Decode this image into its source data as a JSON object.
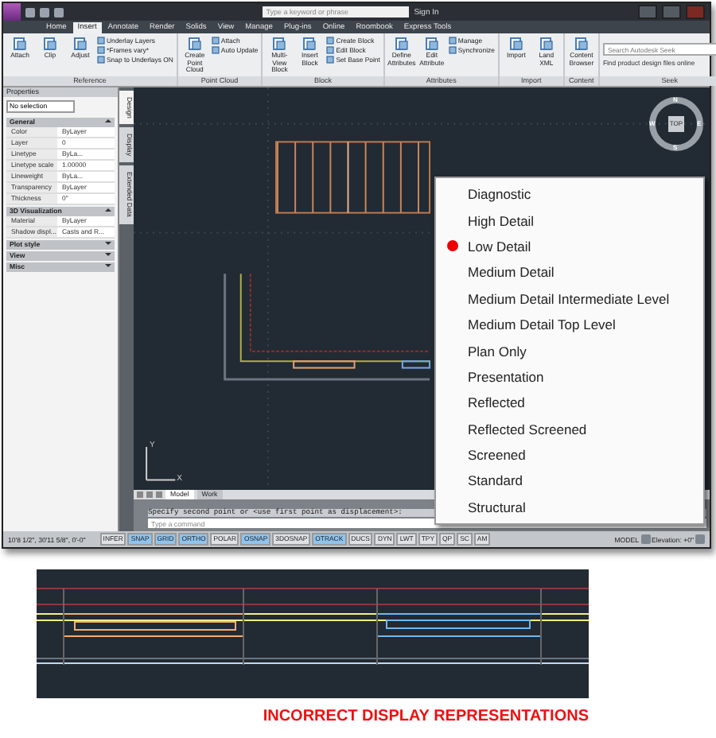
{
  "title_bar": {
    "search": {
      "placeholder": "Type a keyword or phrase"
    },
    "sign_in": "Sign In"
  },
  "ribbon_tabs": [
    {
      "label": "Home",
      "selected": false
    },
    {
      "label": "Insert",
      "selected": true
    },
    {
      "label": "Annotate",
      "selected": false
    },
    {
      "label": "Render",
      "selected": false
    },
    {
      "label": "Solids",
      "selected": false
    },
    {
      "label": "View",
      "selected": false
    },
    {
      "label": "Manage",
      "selected": false
    },
    {
      "label": "Plug-ins",
      "selected": false
    },
    {
      "label": "Online",
      "selected": false
    },
    {
      "label": "Roombook",
      "selected": false
    },
    {
      "label": "Express Tools",
      "selected": false
    }
  ],
  "ribbon_panels": [
    {
      "kind": "tools",
      "title": "Reference",
      "tools": [
        {
          "kind": "large",
          "label": "Attach"
        },
        {
          "kind": "large",
          "label": "Clip"
        },
        {
          "kind": "large",
          "label": "Adjust"
        },
        {
          "kind": "small",
          "label": "Underlay Layers"
        },
        {
          "kind": "small",
          "label": "*Frames vary*"
        },
        {
          "kind": "small",
          "label": "Snap to Underlays ON"
        }
      ]
    },
    {
      "kind": "tools",
      "title": "Point Cloud",
      "tools": [
        {
          "kind": "large",
          "label": "Create Point Cloud"
        },
        {
          "kind": "small",
          "label": "Attach"
        },
        {
          "kind": "small",
          "label": "Auto Update"
        }
      ]
    },
    {
      "kind": "tools",
      "title": "Block",
      "tools": [
        {
          "kind": "large",
          "label": "Multi-View Block"
        },
        {
          "kind": "large",
          "label": "Insert Block"
        },
        {
          "kind": "small",
          "label": "Create Block"
        },
        {
          "kind": "small",
          "label": "Edit Block"
        },
        {
          "kind": "small",
          "label": "Set Base Point"
        }
      ]
    },
    {
      "kind": "tools",
      "title": "Attributes",
      "tools": [
        {
          "kind": "large",
          "label": "Define Attributes"
        },
        {
          "kind": "large",
          "label": "Edit Attribute"
        },
        {
          "kind": "small",
          "label": "Manage"
        },
        {
          "kind": "small",
          "label": "Synchronize"
        }
      ]
    },
    {
      "kind": "tools",
      "title": "Import",
      "tools": [
        {
          "kind": "large",
          "label": "Import"
        },
        {
          "kind": "large",
          "label": "Land XML"
        }
      ]
    },
    {
      "kind": "tools",
      "title": "Content",
      "tools": [
        {
          "kind": "large",
          "label": "Content Browser"
        }
      ]
    },
    {
      "kind": "seek",
      "title": "Seek",
      "search": {
        "placeholder": "Search Autodesk Seek"
      },
      "note": "Find product design files online"
    }
  ],
  "properties": {
    "title": "Properties",
    "selection": "No selection",
    "sections": [
      {
        "title": "General",
        "expanded": true,
        "rows": [
          {
            "label": "Color",
            "value": "ByLayer"
          },
          {
            "label": "Layer",
            "value": "0"
          },
          {
            "label": "Linetype",
            "value": "ByLa..."
          },
          {
            "label": "Linetype scale",
            "value": "1.00000"
          },
          {
            "label": "Lineweight",
            "value": "ByLa..."
          },
          {
            "label": "Transparency",
            "value": "ByLayer"
          },
          {
            "label": "Thickness",
            "value": "0\""
          }
        ]
      },
      {
        "title": "3D Visualization",
        "expanded": true,
        "rows": [
          {
            "label": "Material",
            "value": "ByLayer"
          },
          {
            "label": "Shadow displ...",
            "value": "Casts and R..."
          }
        ]
      },
      {
        "title": "Plot style",
        "expanded": false
      },
      {
        "title": "View",
        "expanded": false
      },
      {
        "title": "Misc",
        "expanded": false
      }
    ],
    "side_tabs": [
      {
        "label": "Design",
        "selected": true
      },
      {
        "label": "Display",
        "selected": false
      },
      {
        "label": "Extended Data",
        "selected": false
      }
    ]
  },
  "view_cube": {
    "face": "TOP",
    "directions": [
      "N",
      "W",
      "E",
      "S"
    ]
  },
  "ucs_icon": {
    "labels": [
      "Y",
      "X"
    ]
  },
  "context_menu": [
    {
      "label": "Diagnostic",
      "selected": false
    },
    {
      "label": "High Detail",
      "selected": false
    },
    {
      "label": "Low Detail",
      "selected": true
    },
    {
      "label": "Medium Detail",
      "selected": false
    },
    {
      "label": "Medium Detail Intermediate Level",
      "selected": false
    },
    {
      "label": "Medium Detail Top Level",
      "selected": false
    },
    {
      "label": "Plan Only",
      "selected": false
    },
    {
      "label": "Presentation",
      "selected": false
    },
    {
      "label": "Reflected",
      "selected": false
    },
    {
      "label": "Reflected Screened",
      "selected": false
    },
    {
      "label": "Screened",
      "selected": false
    },
    {
      "label": "Standard",
      "selected": false
    },
    {
      "label": "Structural",
      "selected": false
    }
  ],
  "layout_tabs": [
    {
      "label": "Model",
      "selected": true
    },
    {
      "label": "Work",
      "selected": false
    }
  ],
  "command_line": {
    "history": "Specify second point or <use first point as displacement>:",
    "placeholder": "Type a command"
  },
  "status_bar": {
    "coordinates": "10'8 1/2\", 30'11 5/8\", 0'-0\"",
    "toggles": [
      {
        "label": "INFER",
        "on": false
      },
      {
        "label": "SNAP",
        "on": true
      },
      {
        "label": "GRID",
        "on": true
      },
      {
        "label": "ORTHO",
        "on": true
      },
      {
        "label": "POLAR",
        "on": false
      },
      {
        "label": "OSNAP",
        "on": true
      },
      {
        "label": "3DOSNAP",
        "on": false
      },
      {
        "label": "OTRACK",
        "on": true
      },
      {
        "label": "DUCS",
        "on": false
      },
      {
        "label": "DYN",
        "on": false
      },
      {
        "label": "LWT",
        "on": false
      },
      {
        "label": "TPY",
        "on": false
      },
      {
        "label": "QP",
        "on": false
      },
      {
        "label": "SC",
        "on": false
      },
      {
        "label": "AM",
        "on": false
      }
    ],
    "space": "MODEL",
    "elevation": "Elevation: +0\""
  },
  "caption": "INCORRECT DISPLAY REPRESENTATIONS"
}
